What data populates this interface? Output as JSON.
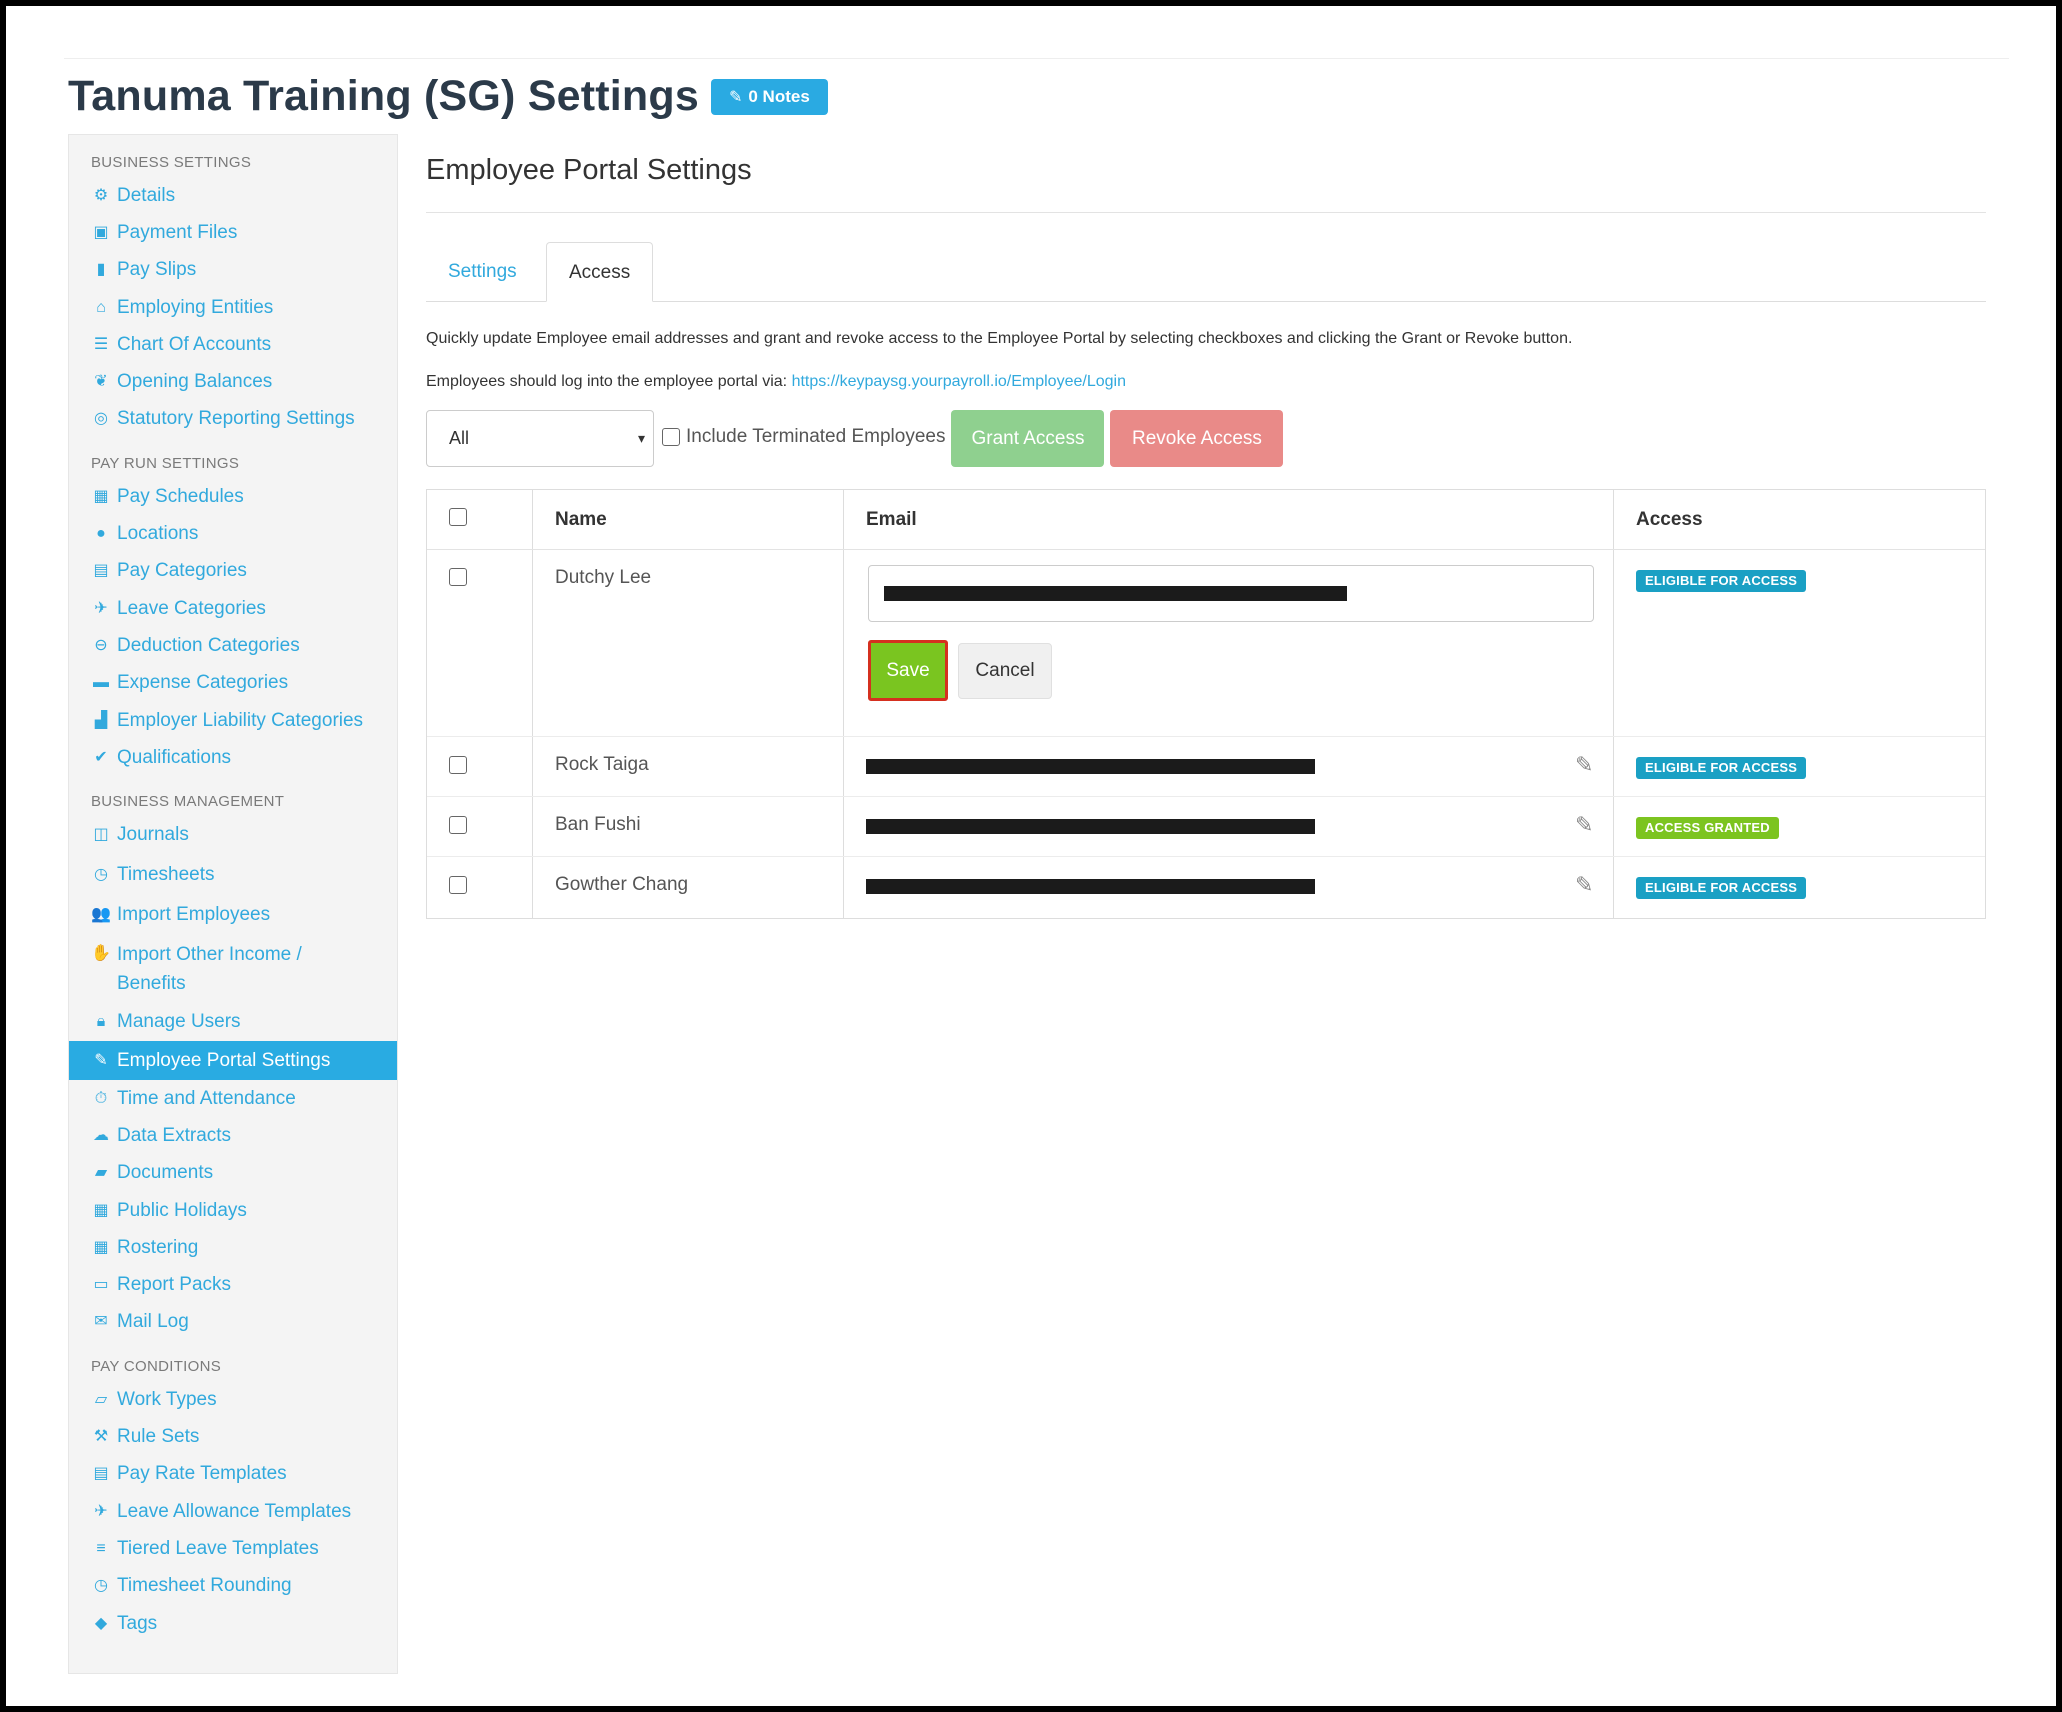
{
  "header": {
    "title": "Tanuma Training (SG) Settings",
    "notes_label": "0 Notes"
  },
  "sidebar": {
    "sections": [
      {
        "title": "BUSINESS SETTINGS",
        "items": [
          {
            "label": "Details",
            "icon": "gear-icon"
          },
          {
            "label": "Payment Files",
            "icon": "floppy-icon"
          },
          {
            "label": "Pay Slips",
            "icon": "file-icon"
          },
          {
            "label": "Employing Entities",
            "icon": "bank-icon"
          },
          {
            "label": "Chart Of Accounts",
            "icon": "list-icon"
          },
          {
            "label": "Opening Balances",
            "icon": "leaf-icon"
          },
          {
            "label": "Statutory Reporting Settings",
            "icon": "lifebuoy-icon"
          }
        ]
      },
      {
        "title": "PAY RUN SETTINGS",
        "items": [
          {
            "label": "Pay Schedules",
            "icon": "calendar-icon"
          },
          {
            "label": "Locations",
            "icon": "globe-icon"
          },
          {
            "label": "Pay Categories",
            "icon": "money-icon"
          },
          {
            "label": "Leave Categories",
            "icon": "plane-icon"
          },
          {
            "label": "Deduction Categories",
            "icon": "minus-circle-icon"
          },
          {
            "label": "Expense Categories",
            "icon": "archive-icon"
          },
          {
            "label": "Employer Liability Categories",
            "icon": "bar-chart-icon"
          },
          {
            "label": "Qualifications",
            "icon": "check-icon"
          }
        ]
      },
      {
        "title": "BUSINESS MANAGEMENT",
        "items": [
          {
            "label": "Journals",
            "icon": "columns-icon"
          },
          {
            "label": "Timesheets",
            "icon": "clock-icon"
          },
          {
            "label": "Import Employees",
            "icon": "users-icon"
          },
          {
            "label": "Import Other Income / Benefits",
            "icon": "hand-coin-icon"
          },
          {
            "label": "Manage Users",
            "icon": "lock-icon"
          },
          {
            "label": "Employee Portal Settings",
            "icon": "magic-wand-icon",
            "active": true
          },
          {
            "label": "Time and Attendance",
            "icon": "stopwatch-icon"
          },
          {
            "label": "Data Extracts",
            "icon": "cloud-download-icon"
          },
          {
            "label": "Documents",
            "icon": "folder-icon"
          },
          {
            "label": "Public Holidays",
            "icon": "calendar-icon"
          },
          {
            "label": "Rostering",
            "icon": "calendar-grid-icon"
          },
          {
            "label": "Report Packs",
            "icon": "folder-open-icon"
          },
          {
            "label": "Mail Log",
            "icon": "envelope-icon"
          }
        ]
      },
      {
        "title": "PAY CONDITIONS",
        "items": [
          {
            "label": "Work Types",
            "icon": "book-icon"
          },
          {
            "label": "Rule Sets",
            "icon": "gavel-icon"
          },
          {
            "label": "Pay Rate Templates",
            "icon": "money-icon"
          },
          {
            "label": "Leave Allowance Templates",
            "icon": "plane-icon"
          },
          {
            "label": "Tiered Leave Templates",
            "icon": "tiers-icon"
          },
          {
            "label": "Timesheet Rounding",
            "icon": "clock-icon"
          },
          {
            "label": "Tags",
            "icon": "tag-icon"
          }
        ]
      }
    ]
  },
  "main": {
    "title": "Employee Portal Settings",
    "tabs": [
      {
        "label": "Settings",
        "active": false
      },
      {
        "label": "Access",
        "active": true
      }
    ],
    "description": "Quickly update Employee email addresses and grant and revoke access to the Employee Portal by selecting checkboxes and clicking the Grant or Revoke button.",
    "login_prefix": "Employees should log into the employee portal via:",
    "login_url": "https://keypaysg.yourpayroll.io/Employee/Login",
    "filter_value": "All",
    "include_terminated_label": "Include Terminated Employees",
    "grant_label": "Grant Access",
    "revoke_label": "Revoke Access",
    "table": {
      "headers": {
        "name": "Name",
        "email": "Email",
        "access": "Access"
      },
      "editing_row": {
        "name": "Dutchy Lee",
        "status": "ELIGIBLE FOR ACCESS",
        "status_type": "eligible",
        "save_label": "Save",
        "cancel_label": "Cancel"
      },
      "rows": [
        {
          "name": "Rock Taiga",
          "status": "ELIGIBLE FOR ACCESS",
          "status_type": "eligible"
        },
        {
          "name": "Ban Fushi",
          "status": "ACCESS GRANTED",
          "status_type": "granted"
        },
        {
          "name": "Gowther Chang",
          "status": "ELIGIBLE FOR ACCESS",
          "status_type": "eligible"
        }
      ]
    }
  },
  "colors": {
    "accent": "#29abe2",
    "grant": "#8fd08f",
    "revoke": "#e98a88",
    "save": "#7ac520",
    "eligible_badge": "#1aa0c4",
    "granted_badge": "#7cc420"
  }
}
